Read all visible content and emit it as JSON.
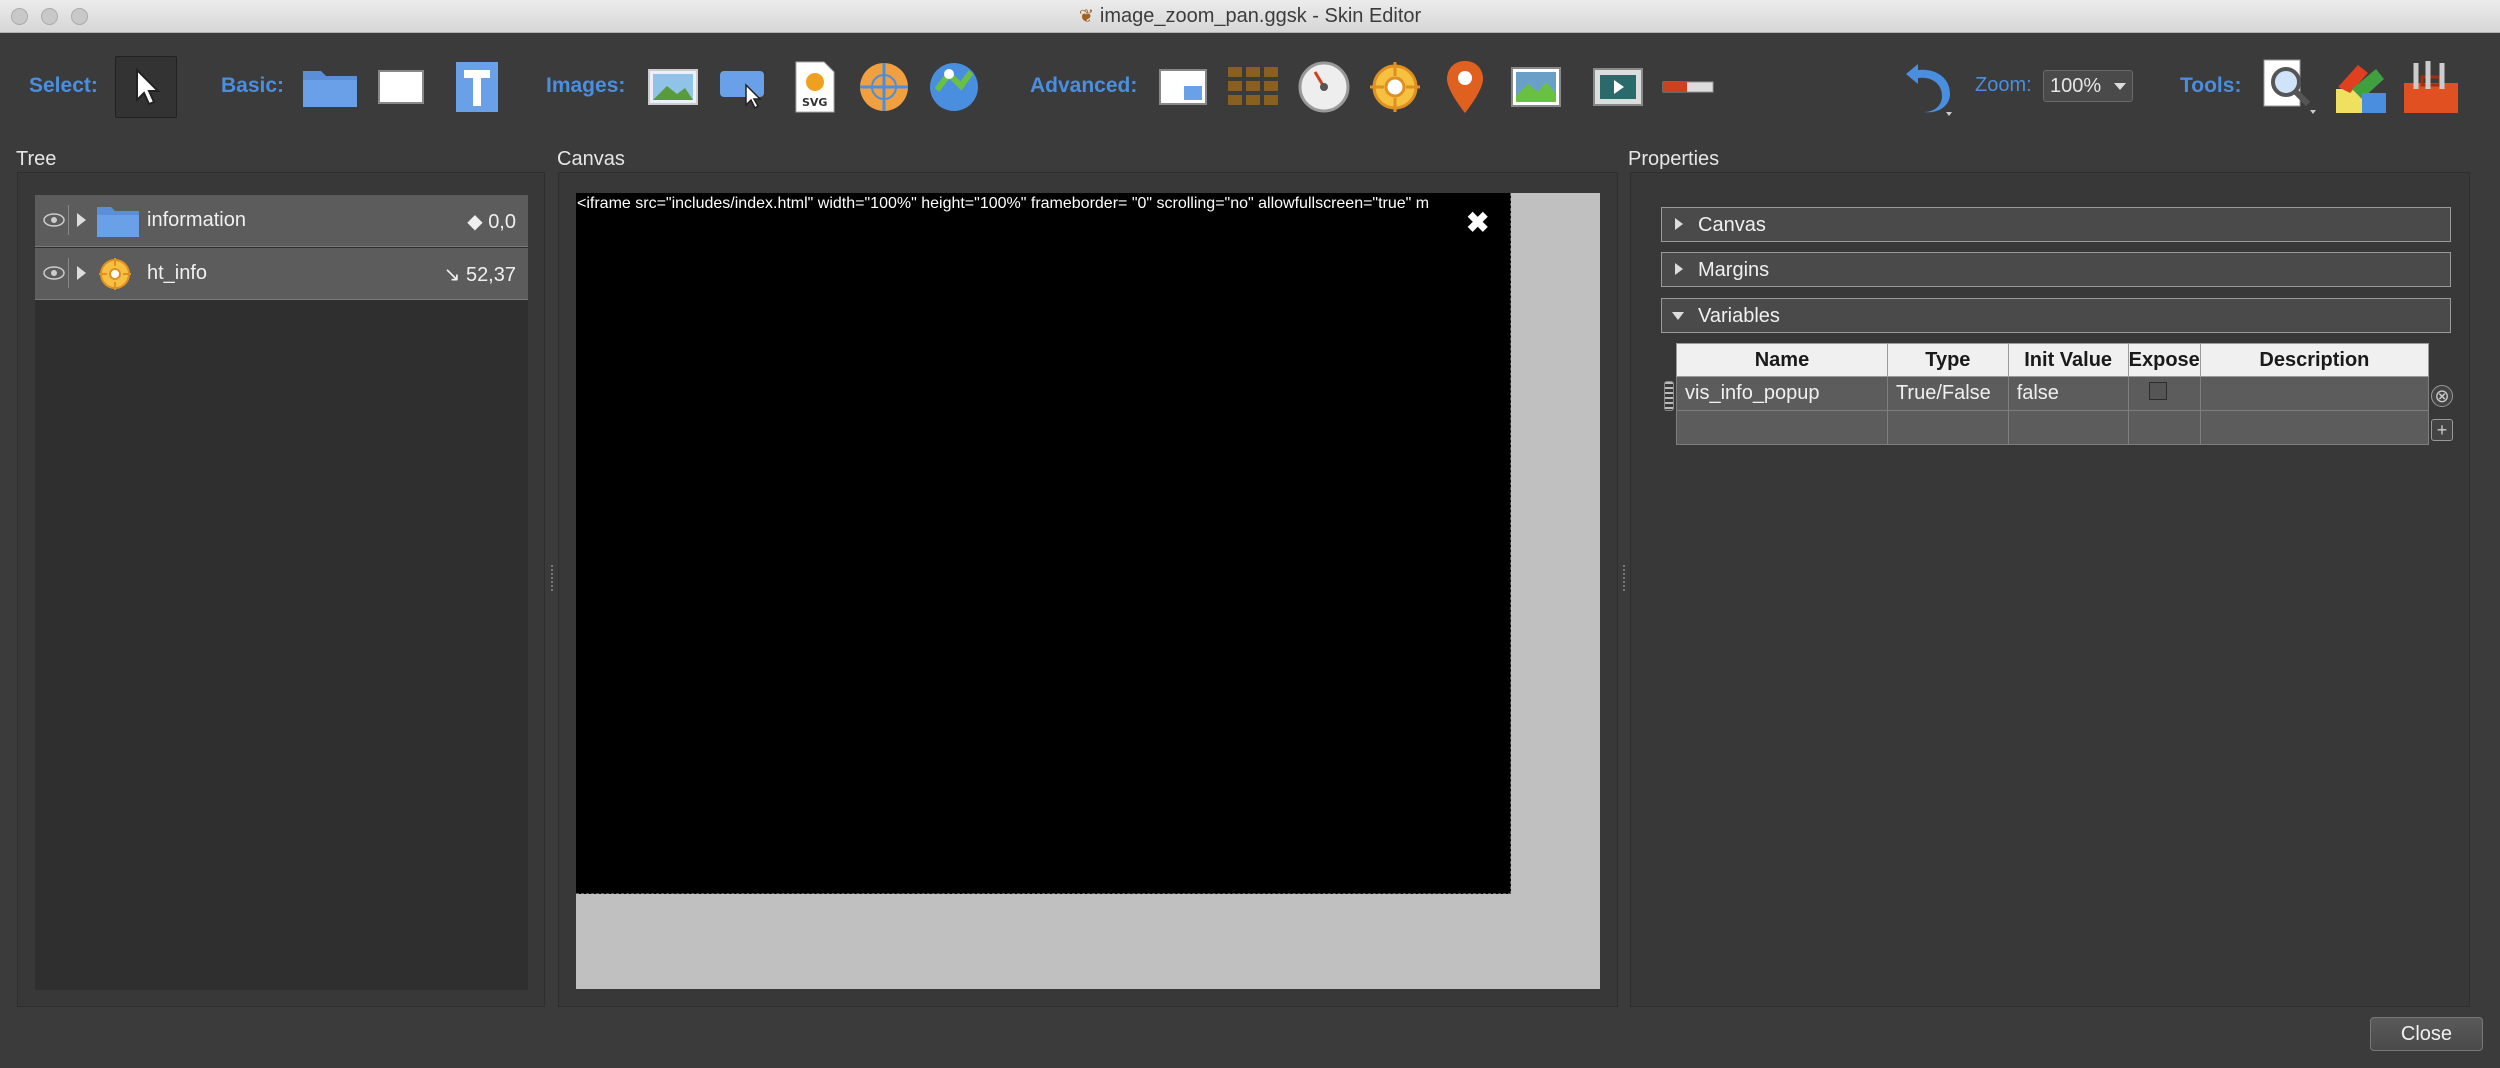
{
  "window": {
    "title": "image_zoom_pan.ggsk - Skin Editor"
  },
  "toolbar": {
    "select_label": "Select:",
    "basic_label": "Basic:",
    "images_label": "Images:",
    "advanced_label": "Advanced:",
    "zoom_label": "Zoom:",
    "zoom_value": "100%",
    "tools_label": "Tools:",
    "icons": {
      "select": "pointer-icon",
      "basic": [
        "folder-icon",
        "rectangle-icon",
        "text-icon"
      ],
      "images": [
        "image-icon",
        "image-button-icon",
        "svg-icon",
        "map-globe-icon",
        "hotspot-map-icon"
      ],
      "advanced": [
        "cloner-icon",
        "grid-icon",
        "dial-icon",
        "crosshair-icon",
        "map-pin-icon",
        "map-image-icon",
        "video-icon",
        "progress-bar-icon"
      ],
      "undo": "undo-icon",
      "tools": [
        "inspect-icon",
        "color-palette-icon",
        "toolbox-icon"
      ]
    },
    "accent": "#4a8ee0"
  },
  "tree": {
    "title": "Tree",
    "rows": [
      {
        "label": "information",
        "value": "◆ 0,0",
        "icon": "folder-icon"
      },
      {
        "label": "ht_info",
        "value": "↘ 52,37",
        "icon": "hotspot-icon"
      }
    ]
  },
  "canvas": {
    "title": "Canvas",
    "iframe_text": "<iframe src=\"includes/index.html\" width=\"100%\" height=\"100%\" frameborder= \"0\" scrolling=\"no\" allowfullscreen=\"true\" m",
    "close_glyph": "✖"
  },
  "properties": {
    "title": "Properties",
    "sections": [
      "Canvas",
      "Margins",
      "Variables"
    ],
    "variables": {
      "columns": [
        "Name",
        "Type",
        "Init Value",
        "Expose",
        "Description"
      ],
      "rows": [
        {
          "name": "vis_info_popup",
          "type": "True/False",
          "init": "false",
          "description": ""
        }
      ]
    }
  },
  "footer": {
    "close_label": "Close"
  }
}
